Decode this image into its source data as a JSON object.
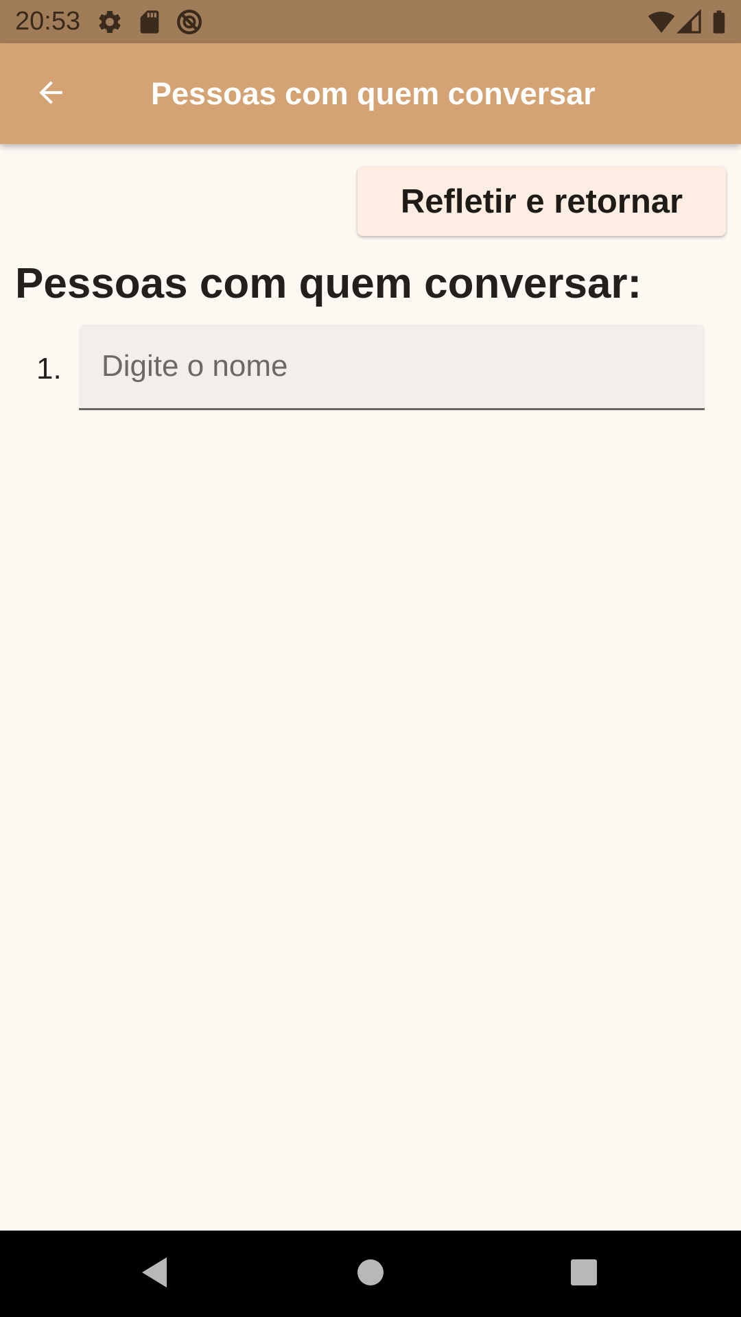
{
  "status_bar": {
    "time": "20:53",
    "icons_left": [
      "settings-icon",
      "sd-card-icon",
      "do-not-disturb-icon"
    ],
    "icons_right": [
      "wifi-icon",
      "signal-icon",
      "battery-icon"
    ]
  },
  "app_bar": {
    "back_icon": "arrow-back-icon",
    "title": "Pessoas com quem conversar"
  },
  "actions": {
    "reflect_label": "Refletir e retornar"
  },
  "section": {
    "heading": "Pessoas com quem conversar:",
    "items": [
      {
        "number": "1.",
        "value": "",
        "placeholder": "Digite o nome"
      }
    ]
  },
  "nav_bar": {
    "buttons": [
      "back-triangle-icon",
      "home-circle-icon",
      "recents-square-icon"
    ]
  },
  "colors": {
    "status_bar": "#a07c58",
    "app_bar": "#d4a373",
    "background": "#fef8f3",
    "button": "#fdede2",
    "field": "#f3eee9"
  }
}
